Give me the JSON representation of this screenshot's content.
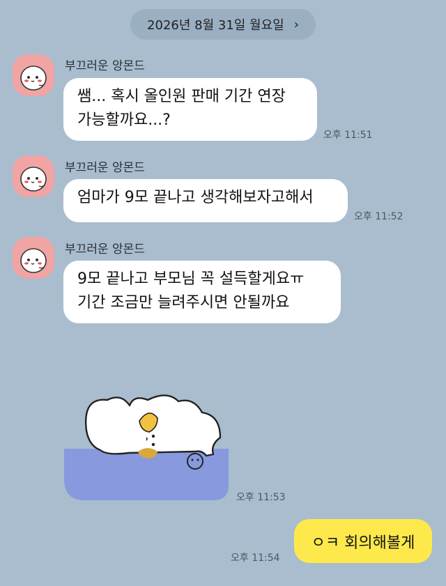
{
  "date_header": {
    "label": "2026년 8월 31일 월요일",
    "chevron": "›"
  },
  "messages": [
    {
      "sender": "부끄러운 앙몬드",
      "lines": [
        "쌤... 혹시 올인원 판매 기간 연장",
        "가능할까요...?"
      ],
      "time": "오후 11:51"
    },
    {
      "sender": "부끄러운 앙몬드",
      "lines": [
        "엄마가 9모 끝나고 생각해보자고해서"
      ],
      "time": "오후 11:52"
    },
    {
      "sender": "부끄러운 앙몬드",
      "lines": [
        "9모 끝나고 부모님 꼭 설득할게요ㅠ",
        "기간 조금만 늘려주시면 안될까요"
      ],
      "time": "오후 11:53"
    }
  ],
  "sticker": {
    "icon": "sleepy-puppy-sticker",
    "time": "오후 11:53"
  },
  "my_message": {
    "text": "ㅇㅋ 회의해볼게",
    "time": "오후 11:54"
  },
  "colors": {
    "background": "#a9bdce",
    "my_bubble": "#fde94b",
    "other_bubble": "#ffffff",
    "avatar": "#f0a4a4"
  }
}
